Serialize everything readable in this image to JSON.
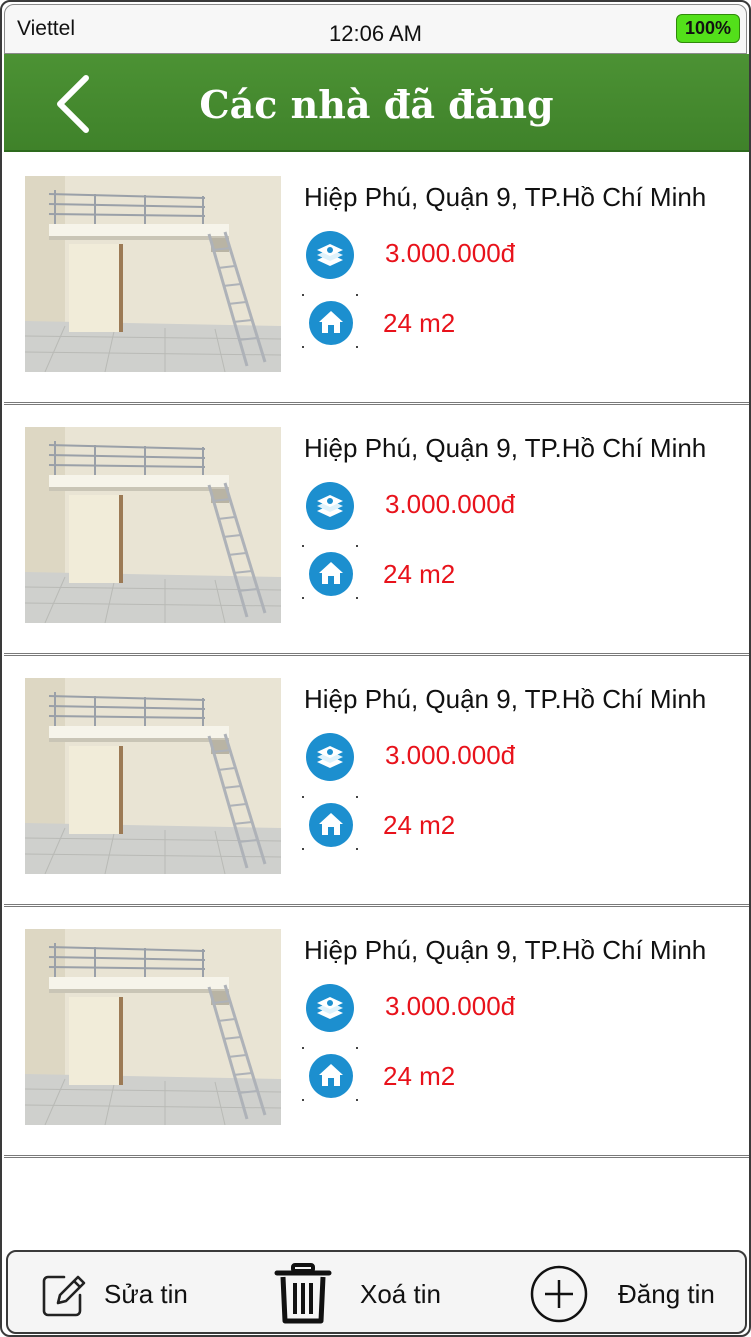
{
  "status_bar": {
    "carrier": "Viettel",
    "time": "12:06 AM",
    "battery": "100%"
  },
  "nav": {
    "title": "Các nhà đã đăng",
    "back_icon": "chevron-left-icon",
    "color": "#46892f"
  },
  "listings": [
    {
      "address": "Hiệp Phú, Quận 9, TP.Hồ Chí Minh",
      "price": "3.000.000đ",
      "area": "24 m2"
    },
    {
      "address": "Hiệp Phú, Quận 9, TP.Hồ Chí Minh",
      "price": "3.000.000đ",
      "area": "24 m2"
    },
    {
      "address": "Hiệp Phú, Quận 9, TP.Hồ Chí Minh",
      "price": "3.000.000đ",
      "area": "24 m2"
    },
    {
      "address": "Hiệp Phú, Quận 9, TP.Hồ Chí Minh",
      "price": "3.000.000đ",
      "area": "24 m2"
    }
  ],
  "toolbar": {
    "edit_label": "Sửa tin",
    "delete_label": "Xoá tin",
    "post_label": "Đăng tin"
  },
  "colors": {
    "price_red": "#e8121b",
    "icon_blue": "#1c8fcf",
    "battery_green": "#53e01a"
  }
}
